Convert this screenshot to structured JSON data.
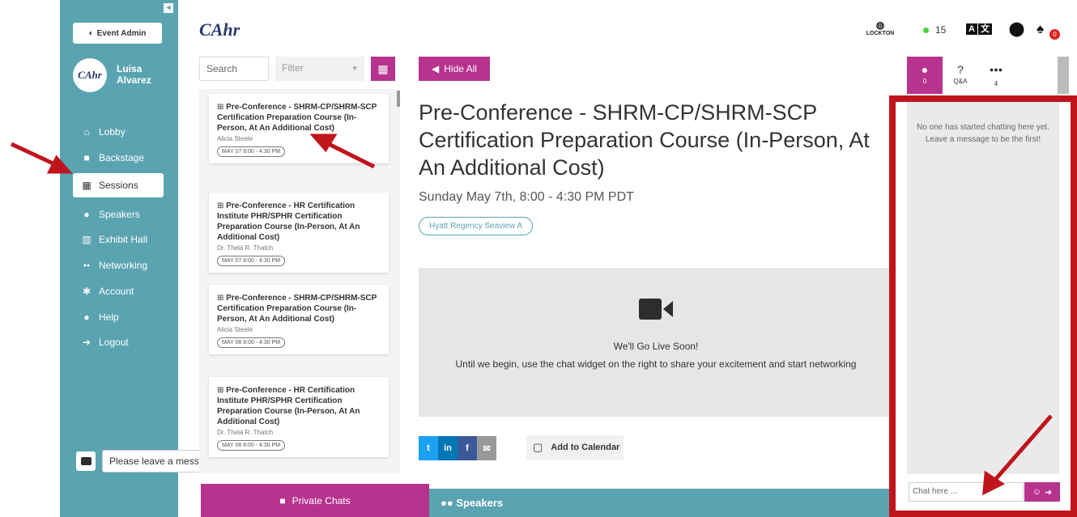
{
  "sidebar": {
    "event_admin": "Event Admin",
    "user_first": "Luisa",
    "user_last": "Alvarez",
    "avatar_text": "CAhr",
    "items": [
      {
        "label": "Lobby",
        "icon": "home-icon",
        "glyph": "⌂"
      },
      {
        "label": "Backstage",
        "icon": "video-icon",
        "glyph": "■"
      },
      {
        "label": "Sessions",
        "icon": "calendar-icon",
        "glyph": "▦"
      },
      {
        "label": "Speakers",
        "icon": "user-icon",
        "glyph": "●"
      },
      {
        "label": "Exhibit Hall",
        "icon": "building-icon",
        "glyph": "▥"
      },
      {
        "label": "Networking",
        "icon": "users-icon",
        "glyph": "●●"
      },
      {
        "label": "Account",
        "icon": "gear-icon",
        "glyph": "✱"
      },
      {
        "label": "Help",
        "icon": "info-icon",
        "glyph": "●"
      },
      {
        "label": "Logout",
        "icon": "logout-icon",
        "glyph": "➜"
      }
    ],
    "active_item": "Sessions"
  },
  "leave_message": "Please leave a message!",
  "header": {
    "logo": "CAhr",
    "sponsor": "LOCKTON",
    "online_count": "15"
  },
  "sessions_panel": {
    "search_placeholder": "Search",
    "filter_placeholder": "Filter",
    "cards": [
      {
        "title": "Pre-Conference - SHRM-CP/SHRM-SCP Certification Preparation Course (In-Person, At An Additional Cost)",
        "speaker": "Alicia Steele",
        "time": "MAY 07 8:00 - 4:30 PM"
      },
      {
        "title": "Pre-Conference - HR Certification Institute PHR/SPHR Certification Preparation Course (In-Person, At An Additional Cost)",
        "speaker": "Dr. Thelá R. Thatch",
        "time": "MAY 07 8:00 - 4:30 PM"
      },
      {
        "title": "Pre-Conference - SHRM-CP/SHRM-SCP Certification Preparation Course (In-Person, At An Additional Cost)",
        "speaker": "Alicia Steele",
        "time": "MAY 08 8:00 - 4:30 PM"
      },
      {
        "title": "Pre-Conference - HR Certification Institute PHR/SPHR Certification Preparation Course (In-Person, At An Additional Cost)",
        "speaker": "Dr. Thelá R. Thatch",
        "time": "MAY 08 8:00 - 4:30 PM"
      }
    ],
    "private_chats": "Private Chats"
  },
  "main": {
    "hide_all": "Hide All",
    "title": "Pre-Conference - SHRM-CP/SHRM-SCP Certification Preparation Course (In-Person, At An Additional Cost)",
    "date": "Sunday May 7th, 8:00 - 4:30 PM PDT",
    "location": "Hyatt Regency Seaview A",
    "live_title": "We'll Go Live Soon!",
    "live_sub": "Until we begin, use the chat widget on the right to share your excitement and start networking",
    "add_to_calendar": "Add to Calendar",
    "speakers_heading": "Speakers"
  },
  "chat_panel": {
    "tabs": [
      {
        "label": "0",
        "icon": "chat-icon"
      },
      {
        "label": "Q&A",
        "icon": "question-icon"
      },
      {
        "label": "4",
        "icon": "users-icon"
      }
    ],
    "empty_message": "No one has started chatting here yet. Leave a message to be the first!",
    "input_placeholder": "Chat here ..."
  },
  "colors": {
    "teal": "#5aa3b1",
    "magenta": "#b7338e",
    "annotation_red": "#c0141d"
  }
}
